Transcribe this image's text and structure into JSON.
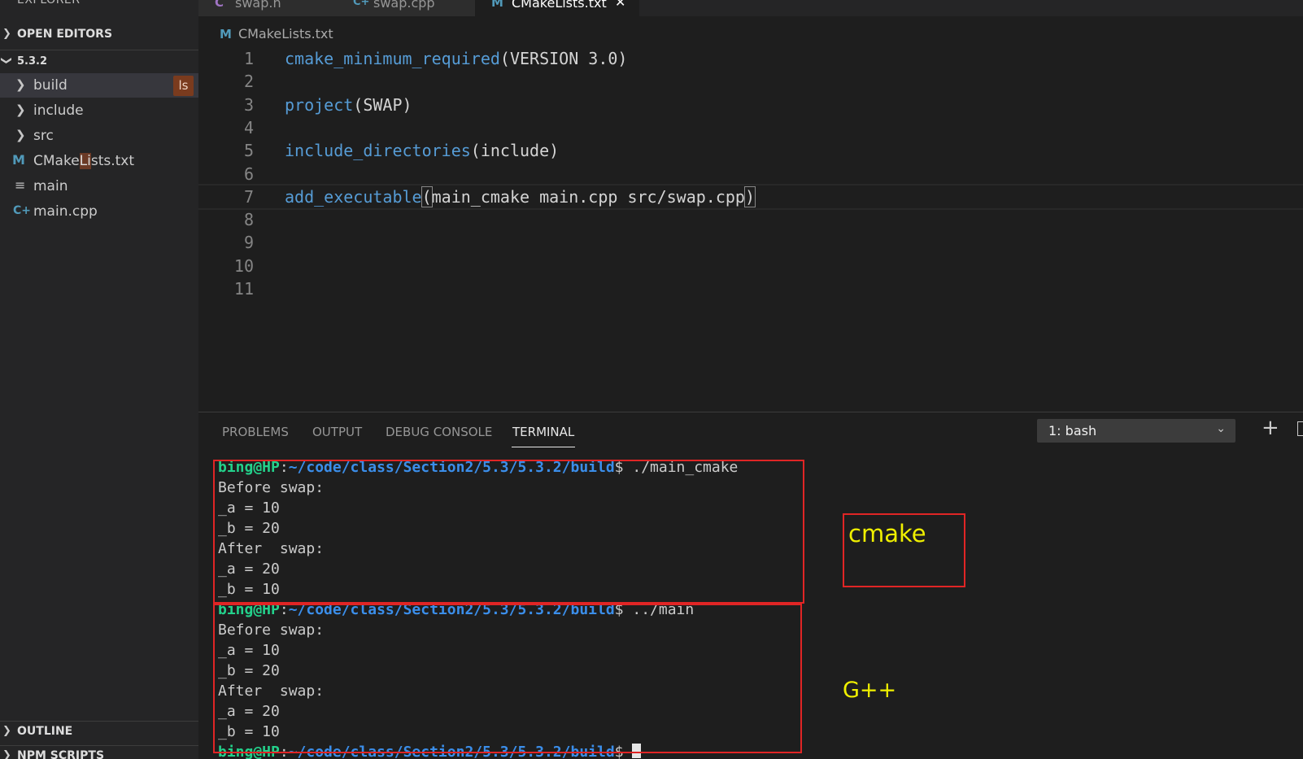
{
  "sidebar": {
    "title": "EXPLORER",
    "more_icon": "more-icon",
    "open_editors": "OPEN EDITORS",
    "folder": "5.3.2",
    "items": [
      {
        "label": "build",
        "type": "folder",
        "badge": "ls"
      },
      {
        "label": "include",
        "type": "folder"
      },
      {
        "label": "src",
        "type": "folder"
      },
      {
        "label_pre": "CMake",
        "label_hl": "Li",
        "label_post": "sts.txt",
        "type": "cmake"
      },
      {
        "label": "main",
        "type": "text"
      },
      {
        "label": "main.cpp",
        "type": "cpp"
      }
    ],
    "outline": "OUTLINE",
    "npm_scripts": "NPM SCRIPTS"
  },
  "tabs": [
    {
      "label": "swap.h",
      "icon": "C"
    },
    {
      "label": "swap.cpp",
      "icon": "C+"
    },
    {
      "label": "CMakeLists.txt",
      "icon": "M",
      "active": true
    }
  ],
  "breadcrumb": {
    "icon": "M",
    "label": "CMakeLists.txt"
  },
  "editor": {
    "lines": [
      {
        "num": "1",
        "fn": "cmake_minimum_required",
        "rest": "(VERSION 3.0)"
      },
      {
        "num": "2",
        "fn": "",
        "rest": ""
      },
      {
        "num": "3",
        "fn": "project",
        "rest": "(SWAP)"
      },
      {
        "num": "4",
        "fn": "",
        "rest": ""
      },
      {
        "num": "5",
        "fn": "include_directories",
        "rest": "(include)"
      },
      {
        "num": "6",
        "fn": "",
        "rest": ""
      },
      {
        "num": "7",
        "fn": "add_executable",
        "open": "(",
        "args": "main_cmake main.cpp src/swap.cpp",
        "close": ")"
      },
      {
        "num": "8"
      },
      {
        "num": "9"
      },
      {
        "num": "10"
      },
      {
        "num": "11"
      }
    ]
  },
  "panel": {
    "tabs": [
      "PROBLEMS",
      "OUTPUT",
      "DEBUG CONSOLE",
      "TERMINAL"
    ],
    "active_tab": "TERMINAL",
    "terminal_select": "1: bash"
  },
  "terminal": {
    "prompt_user": "bing@HP",
    "prompt_path": "~/code/class/Section2/5.3/5.3.2/build",
    "prompt_sign": "$",
    "cmd1": " ./main_cmake",
    "cmd2": " ../main",
    "before": "Before swap:",
    "a10": "_a = 10",
    "b20": "_b = 20",
    "after": "After  swap:",
    "a20": "_a = 20",
    "b10": "_b = 10"
  },
  "annotations": {
    "cmake": "cmake",
    "gpp": "G++",
    "box_color": "#e02525",
    "note_color": "#f0f000"
  }
}
